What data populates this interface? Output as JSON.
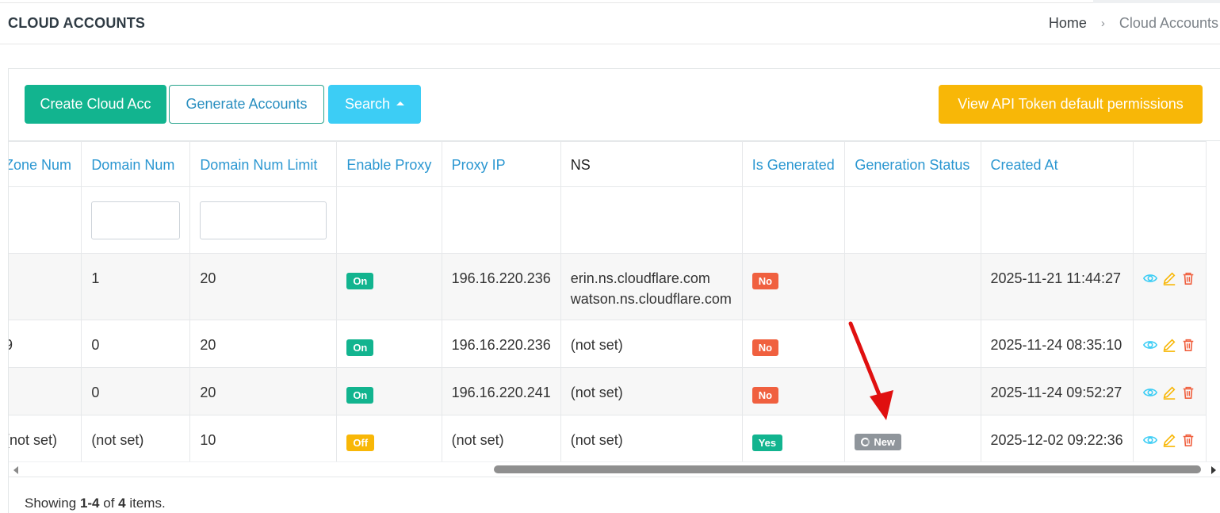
{
  "header": {
    "title": "CLOUD ACCOUNTS",
    "breadcrumb": {
      "home": "Home",
      "separator": "›",
      "current": "Cloud Accounts"
    }
  },
  "toolbar": {
    "create_label": "Create Cloud Acc",
    "generate_label": "Generate Accounts",
    "search_label": "Search",
    "api_label": "View API Token default permissions"
  },
  "colors": {
    "primary_green": "#12b48f",
    "search_cyan": "#3ccdf5",
    "api_yellow": "#f8b707",
    "header_link_blue": "#2b97d1",
    "badge_no_red": "#f0603f",
    "badge_new_gray": "#8f959b",
    "annotation_arrow": "#e01010"
  },
  "table": {
    "columns": [
      "Zone Num",
      "Domain Num",
      "Domain Num Limit",
      "Enable Proxy",
      "Proxy IP",
      "NS",
      "Is Generated",
      "Generation Status",
      "Created At",
      ""
    ],
    "rows": [
      {
        "zone_num": "",
        "domain_num": "1",
        "domain_limit": "20",
        "enable_proxy": "On",
        "proxy_ip": "196.16.220.236",
        "ns_line1": "erin.ns.cloudflare.com",
        "ns_line2": "watson.ns.cloudflare.com",
        "is_generated": "No",
        "generation_status": "",
        "created_at": "2025-11-21 11:44:27"
      },
      {
        "zone_num": "9",
        "domain_num": "0",
        "domain_limit": "20",
        "enable_proxy": "On",
        "proxy_ip": "196.16.220.236",
        "ns_line1": "(not set)",
        "ns_line2": "",
        "is_generated": "No",
        "generation_status": "",
        "created_at": "2025-11-24 08:35:10"
      },
      {
        "zone_num": ")",
        "domain_num": "0",
        "domain_limit": "20",
        "enable_proxy": "On",
        "proxy_ip": "196.16.220.241",
        "ns_line1": "(not set)",
        "ns_line2": "",
        "is_generated": "No",
        "generation_status": "",
        "created_at": "2025-11-24 09:52:27"
      },
      {
        "zone_num": "(not set)",
        "domain_num": "(not set)",
        "domain_limit": "10",
        "enable_proxy": "Off",
        "proxy_ip": "(not set)",
        "ns_line1": "(not set)",
        "ns_line2": "",
        "is_generated": "Yes",
        "generation_status": "New",
        "created_at": "2025-12-02 09:22:36"
      }
    ]
  },
  "summary": {
    "prefix": "Showing ",
    "range": "1-4",
    "middle": " of ",
    "total": "4",
    "suffix": " items."
  }
}
